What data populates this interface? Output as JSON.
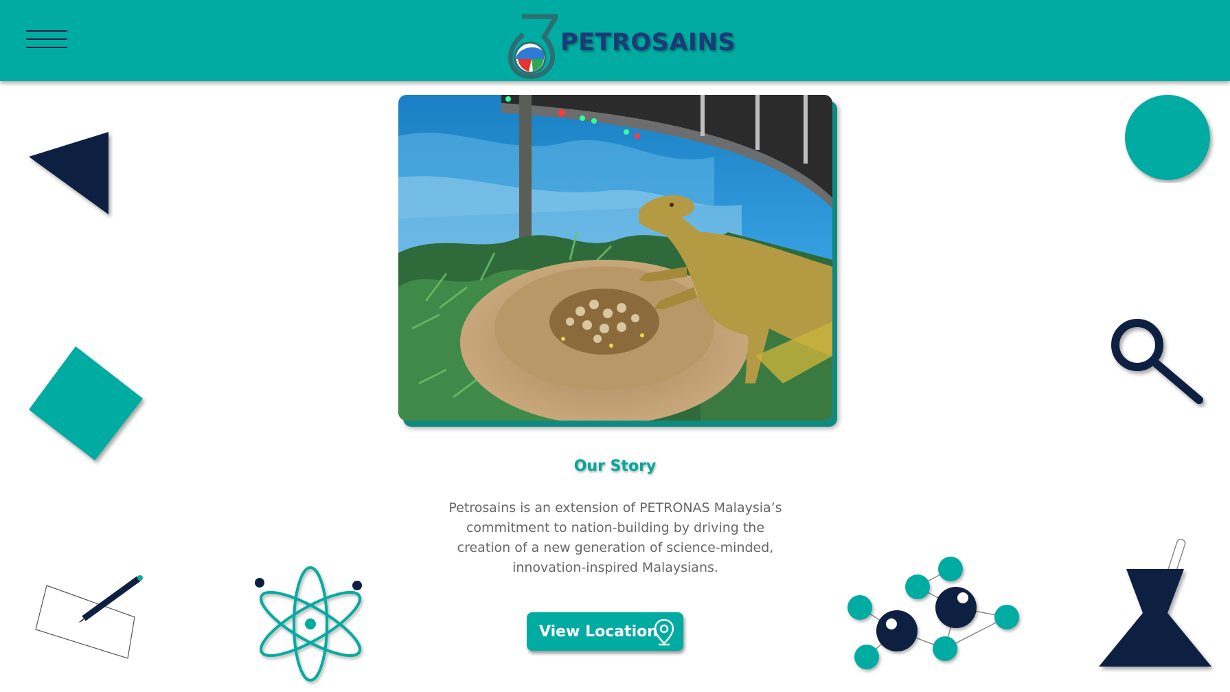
{
  "header": {
    "menu_icon": "hamburger-menu-icon",
    "logo_text": "PETROSAINS",
    "background": "#00aca1"
  },
  "hero": {
    "image_subject": "dinosaur-nest-exhibit-photo"
  },
  "story": {
    "title": "Our Story",
    "body": "Petrosains is an extension of PETRONAS Malaysia’s commitment to nation-building by driving the creation of a new generation of science-minded, innovation-inspired Malaysians.",
    "button_label": "View Location",
    "button_icon": "location-pin-icon"
  },
  "decorations": {
    "icons": [
      "triangle-shape",
      "teal-circle-shape",
      "teal-diamond-shape",
      "magnifier-icon",
      "pencil-paper-icon",
      "atom-icon",
      "molecule-icon",
      "flask-icon"
    ]
  },
  "colors": {
    "teal": "#00aca1",
    "navy": "#0e2042",
    "text_gray": "#666666"
  }
}
